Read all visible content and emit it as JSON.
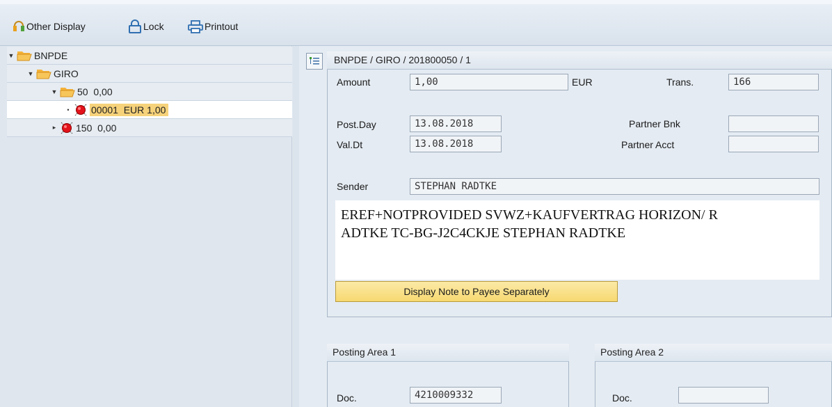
{
  "toolbar": {
    "other_display": "Other Display",
    "lock": "Lock",
    "printout": "Printout"
  },
  "tree": {
    "root": "BNPDE",
    "giro": "GIRO",
    "n50": "50  0,00",
    "item_selected": "00001  EUR 1,00",
    "n150": "150  0,00"
  },
  "detail": {
    "header": "BNPDE / GIRO / 201800050 / 1",
    "amount_label": "Amount",
    "amount_value": "1,00",
    "currency": "EUR",
    "trans_label": "Trans.",
    "trans_value": "166",
    "postday_label": "Post.Day",
    "postday_value": "13.08.2018",
    "valdt_label": "Val.Dt",
    "valdt_value": "13.08.2018",
    "partner_bnk_label": "Partner Bnk",
    "partner_bnk_value": "",
    "partner_acct_label": "Partner Acct",
    "partner_acct_value": "",
    "sender_label": "Sender",
    "sender_value": "STEPHAN RADTKE",
    "note_line1": "EREF+NOTPROVIDED SVWZ+KAUFVERTRAG HORIZON/ R",
    "note_line2": "ADTKE TC-BG-J2C4CKJE STEPHAN RADTKE",
    "note_button": "Display Note to Payee Separately"
  },
  "posting_area_1": {
    "title": "Posting Area 1",
    "doc_label": "Doc.",
    "doc_value": "4210009332"
  },
  "posting_area_2": {
    "title": "Posting Area 2",
    "doc_label": "Doc.",
    "doc_value": ""
  },
  "colors": {
    "selection": "#f6d27a",
    "button_yellow": "#f7d971",
    "panel": "#e4ebf2"
  }
}
